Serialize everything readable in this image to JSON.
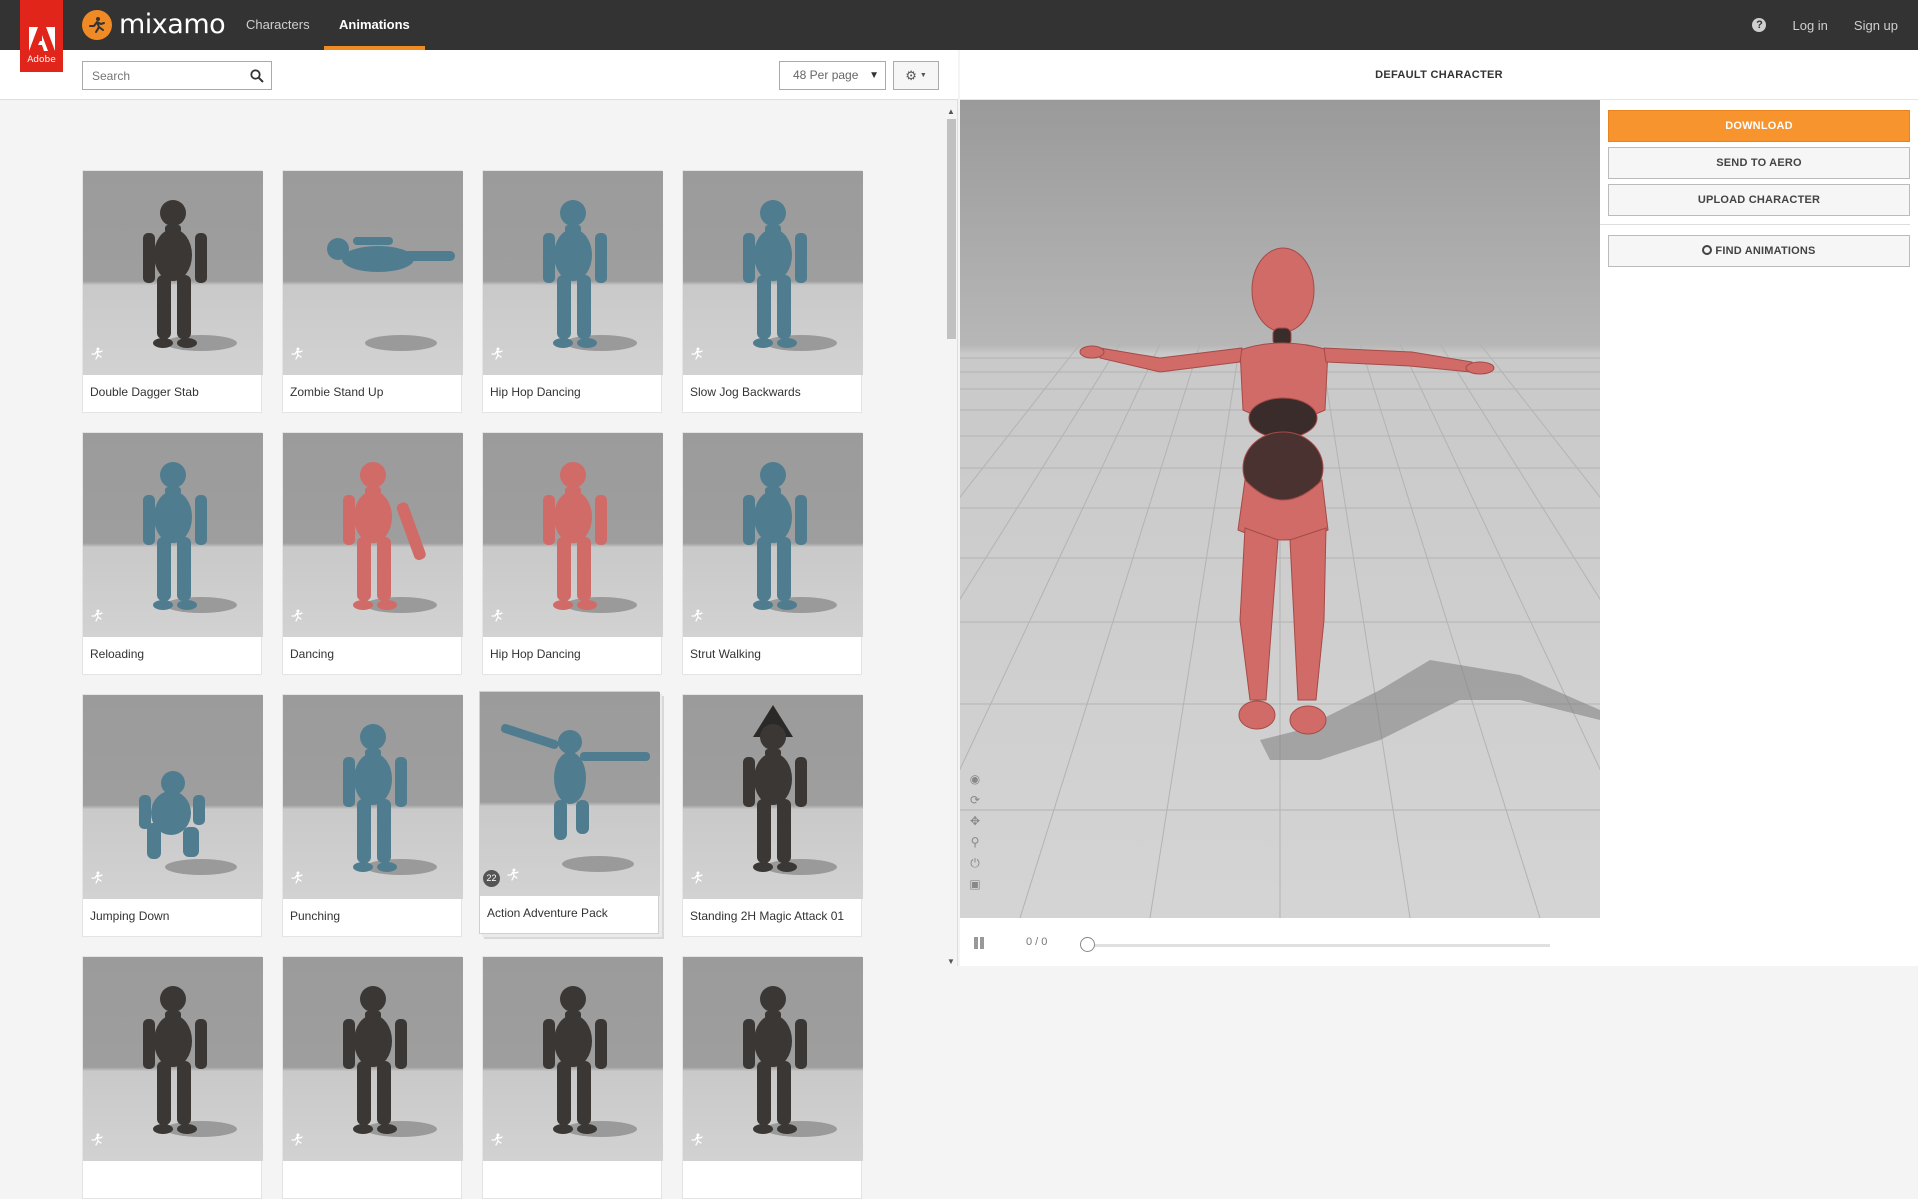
{
  "header": {
    "adobe_label": "Adobe",
    "logo_text": "mixamo",
    "nav": [
      {
        "label": "Characters",
        "active": false
      },
      {
        "label": "Animations",
        "active": true
      }
    ],
    "login": "Log in",
    "signup": "Sign up",
    "help_glyph": "?"
  },
  "toolbar": {
    "search_placeholder": "Search",
    "per_page": "48 Per page"
  },
  "cards": [
    {
      "label": "Double Dagger Stab",
      "figure": "dark"
    },
    {
      "label": "Zombie Stand Up",
      "figure": "blue-lying"
    },
    {
      "label": "Hip Hop Dancing",
      "figure": "blue"
    },
    {
      "label": "Slow Jog Backwards",
      "figure": "blue"
    },
    {
      "label": "Reloading",
      "figure": "blue"
    },
    {
      "label": "Dancing",
      "figure": "red-bent"
    },
    {
      "label": "Hip Hop Dancing",
      "figure": "red"
    },
    {
      "label": "Strut Walking",
      "figure": "blue"
    },
    {
      "label": "Jumping Down",
      "figure": "blue-crouch"
    },
    {
      "label": "Punching",
      "figure": "blue"
    },
    {
      "label": "Action Adventure Pack",
      "figure": "blue-jump",
      "pack_count": "22"
    },
    {
      "label": "Standing 2H Magic Attack 01",
      "figure": "dark-wizard"
    },
    {
      "label": "",
      "figure": "dark"
    },
    {
      "label": "",
      "figure": "dark"
    },
    {
      "label": "",
      "figure": "dark"
    },
    {
      "label": "",
      "figure": "dark"
    }
  ],
  "viewer": {
    "title": "DEFAULT CHARACTER",
    "frames": "0 / 0",
    "progress": 0
  },
  "actions": {
    "download": "DOWNLOAD",
    "send_to_aero": "SEND TO AERO",
    "upload_character": "UPLOAD CHARACTER",
    "find_animations": "FIND ANIMATIONS"
  },
  "colors": {
    "accent": "#f7942d",
    "adobe_red": "#e1251b",
    "topbar": "#333333",
    "figure_blue": "#4f7d8f",
    "figure_red": "#d06b68",
    "figure_dark": "#3a3734"
  }
}
